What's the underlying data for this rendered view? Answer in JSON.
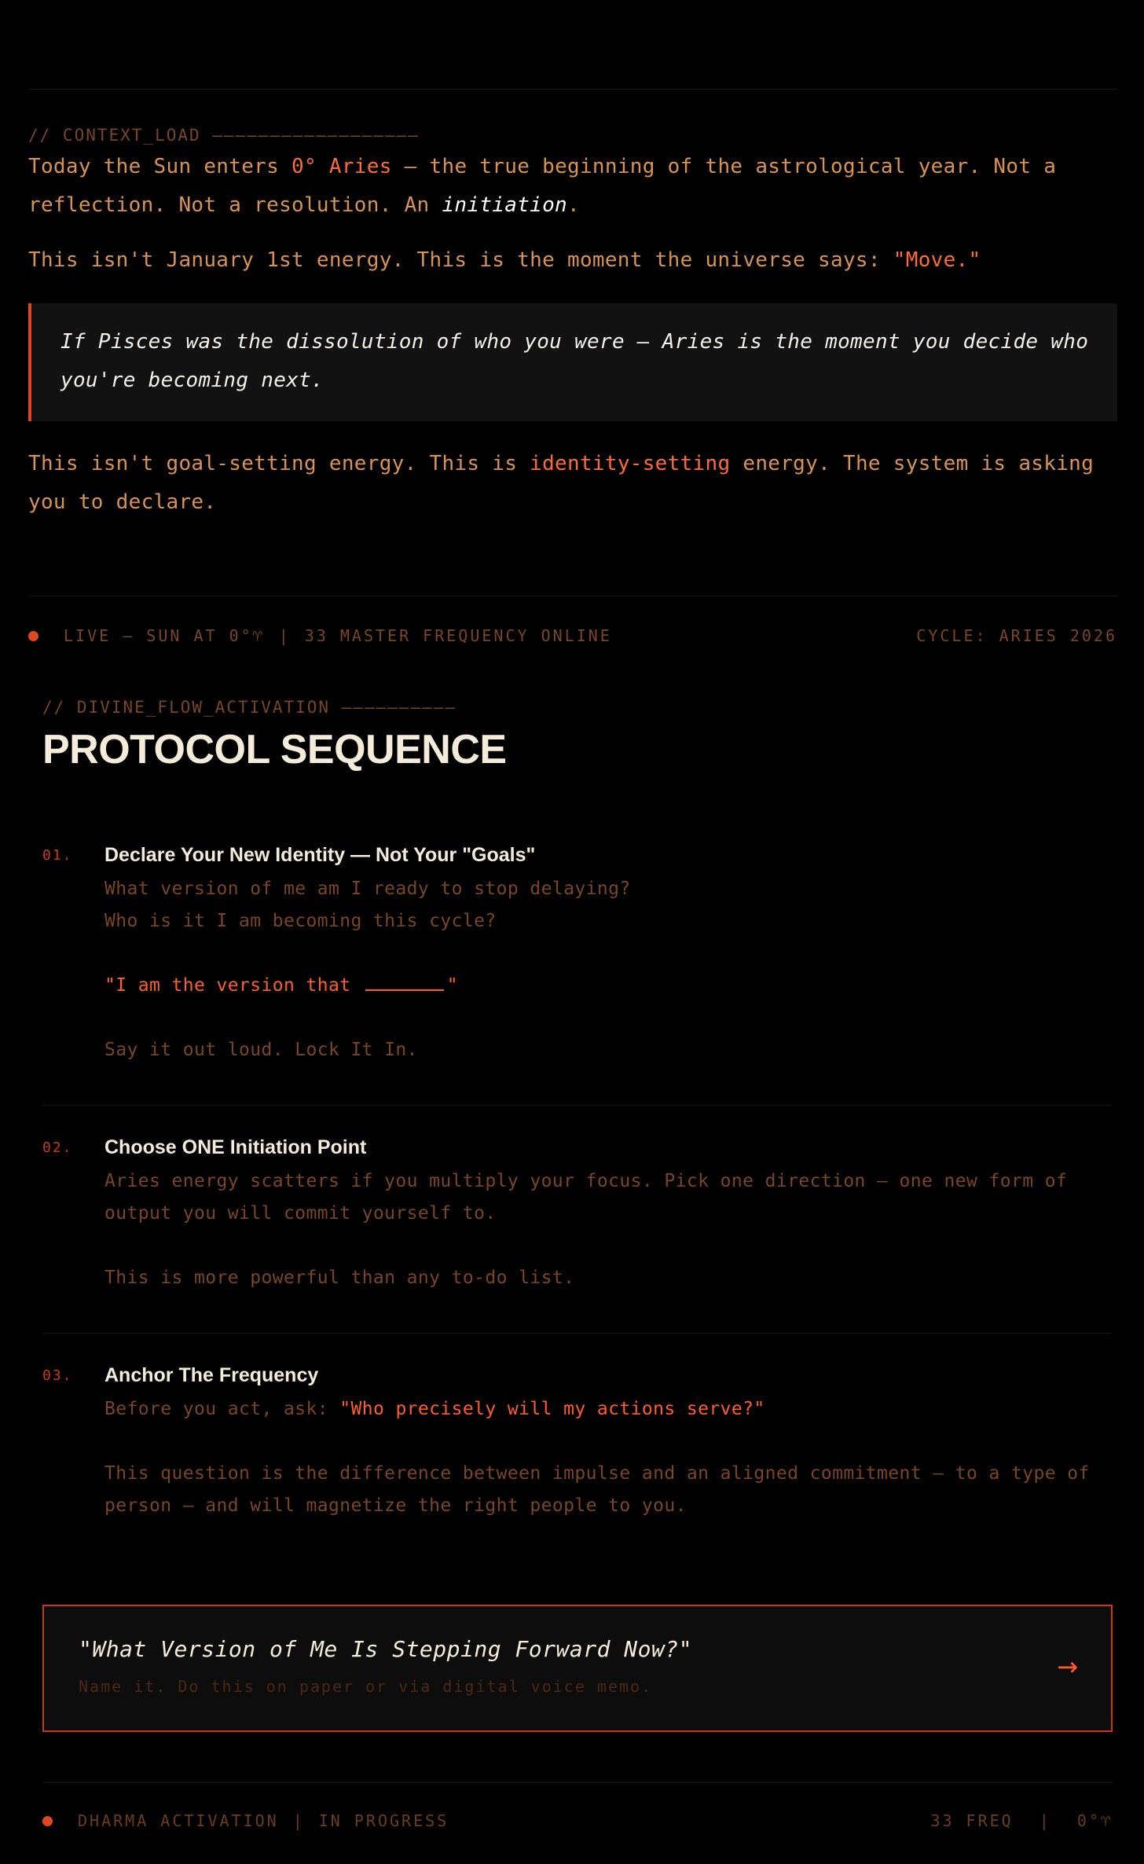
{
  "context": {
    "comment": "// CONTEXT_LOAD ——————————————————",
    "p1_a": "Today the Sun enters ",
    "p1_hl": "0° Aries",
    "p1_b": " — the true beginning of the astrological year. Not a reflection. Not a resolution. An ",
    "p1_it": "initiation",
    "p1_c": ".",
    "p2_a": "This isn't January 1st energy. This is the moment the universe says: ",
    "p2_hl": "\"Move.\"",
    "quote": "If Pisces was the dissolution of who you were — Aries is the moment you decide who you're becoming next.",
    "p3_a": "This isn't goal-setting energy. This is ",
    "p3_hl": "identity-setting",
    "p3_b": " energy. The system is asking you to declare."
  },
  "status_bar": {
    "live": "LIVE — SUN AT 0°♈",
    "sep": "|",
    "freq": "33 MASTER FREQUENCY ONLINE",
    "cycle": "CYCLE: ARIES 2026"
  },
  "protocol": {
    "comment": "// DIVINE_FLOW_ACTIVATION ——————————",
    "title": "PROTOCOL SEQUENCE",
    "steps": [
      {
        "num": "01.",
        "title": "Declare Your New Identity — Not Your \"Goals\"",
        "line1": "What version of me am I ready to stop delaying?",
        "line2": "Who is it I am becoming this cycle?",
        "declare_a": "\"I am the version that ",
        "declare_b": "\"",
        "line3": "Say it out loud. Lock It In."
      },
      {
        "num": "02.",
        "title": "Choose ONE Initiation Point",
        "line1": "Aries energy scatters if you multiply your focus. Pick one direction — one new form of output you will commit yourself to.",
        "line2": "This is more powerful than any to-do list."
      },
      {
        "num": "03.",
        "title": "Anchor The Frequency",
        "line1_a": "Before you act, ask: ",
        "line1_hl": "\"Who precisely will my actions serve?\"",
        "line2": "This question is the difference between impulse and an aligned commitment — to a type of person — and will magnetize the right people to you."
      }
    ]
  },
  "cta": {
    "title": "\"What Version of Me Is Stepping Forward Now?\"",
    "subtitle": "Name it. Do this on paper or via digital voice memo.",
    "arrow": "→"
  },
  "footer": {
    "left_a": "DHARMA ACTIVATION",
    "sep": "|",
    "left_b": "IN PROGRESS",
    "right_a": "33 FREQ",
    "right_sep": "|",
    "right_b": "0°♈"
  }
}
